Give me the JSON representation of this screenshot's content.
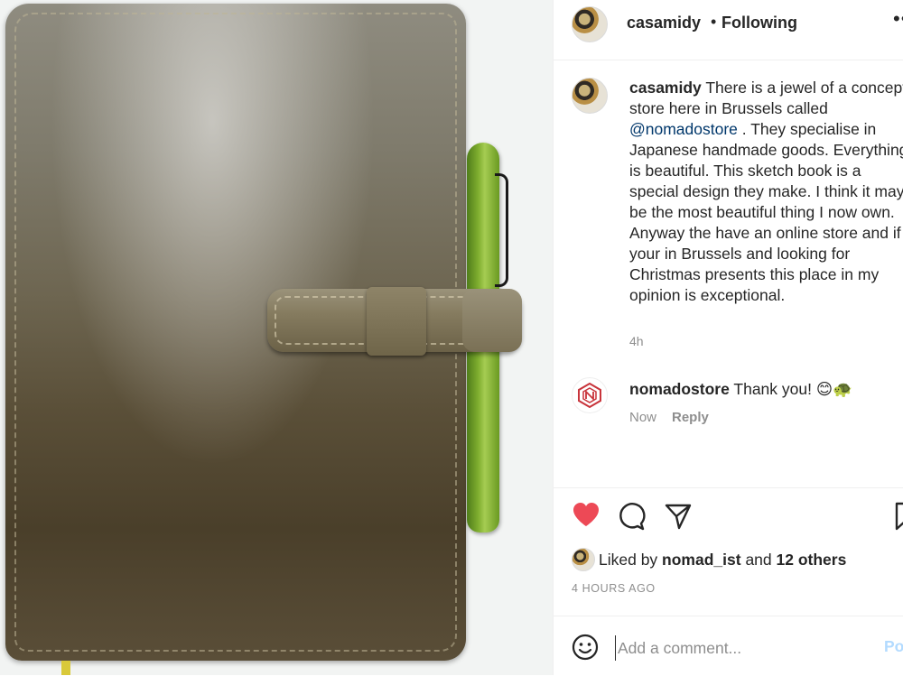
{
  "post": {
    "author": "casamidy",
    "separator": "•",
    "follow_state": "Following",
    "more": "•••"
  },
  "caption": {
    "author": "casamidy",
    "text_before_mention": " There is a jewel of a concept store here in Brussels called ",
    "mention": "@nomadostore",
    "text_after_mention": " . They specialise in Japanese handmade goods. Everything is beautiful. This sketch book is a special design they make. I think it may be the most beautiful thing I now own. Anyway the have an online store and if your in Brussels and looking for Christmas presents this place in my opinion is exceptional.",
    "time": "4h"
  },
  "reply": {
    "author": "nomadostore",
    "text": " Thank you! 😊🐢",
    "time": "Now",
    "reply_label": "Reply"
  },
  "likes": {
    "prefix": "Liked by ",
    "user": "nomad_ist",
    "middle": " and ",
    "others": "12 others"
  },
  "timestamp": "4 HOURS AGO",
  "comment_box": {
    "placeholder": "Add a comment...",
    "post_label": "Po"
  },
  "colors": {
    "like_red": "#ed4956",
    "mention_blue": "#00376b",
    "muted": "#8e8e8e"
  }
}
